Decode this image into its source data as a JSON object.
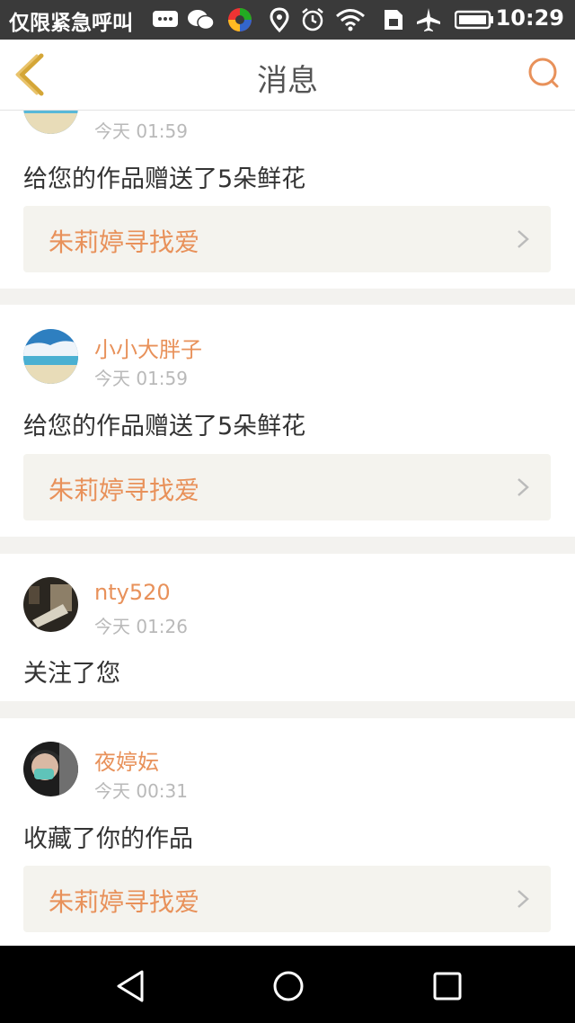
{
  "status_bar": {
    "carrier": "仅限紧急呼叫",
    "time": "10:29",
    "icons": [
      "message-icon",
      "wechat-icon",
      "colorful-app-icon",
      "location-icon",
      "alarm-icon",
      "wifi-icon",
      "sim-icon",
      "airplane-icon",
      "battery-icon"
    ]
  },
  "header": {
    "title": "消息",
    "back_icon": "chevron-left-icon",
    "search_icon": "search-icon"
  },
  "accent_color": "#e8915a",
  "messages": [
    {
      "username": "",
      "time": "今天 01:59",
      "text": "给您的作品赠送了5朵鲜花",
      "work": "朱莉婷寻找爱",
      "avatar": "beach-avatar"
    },
    {
      "username": "小小大胖子",
      "time": "今天 01:59",
      "text": "给您的作品赠送了5朵鲜花",
      "work": "朱莉婷寻找爱",
      "avatar": "beach-avatar"
    },
    {
      "username": "nty520",
      "time": "今天 01:26",
      "text": "关注了您",
      "work": null,
      "avatar": "dark-photo-avatar"
    },
    {
      "username": "夜婷妘",
      "time": "今天 00:31",
      "text": "收藏了你的作品",
      "work": "朱莉婷寻找爱",
      "avatar": "masked-person-avatar"
    }
  ],
  "nav_bar": {
    "back": "nav-back-icon",
    "home": "nav-home-icon",
    "recents": "nav-recents-icon"
  }
}
